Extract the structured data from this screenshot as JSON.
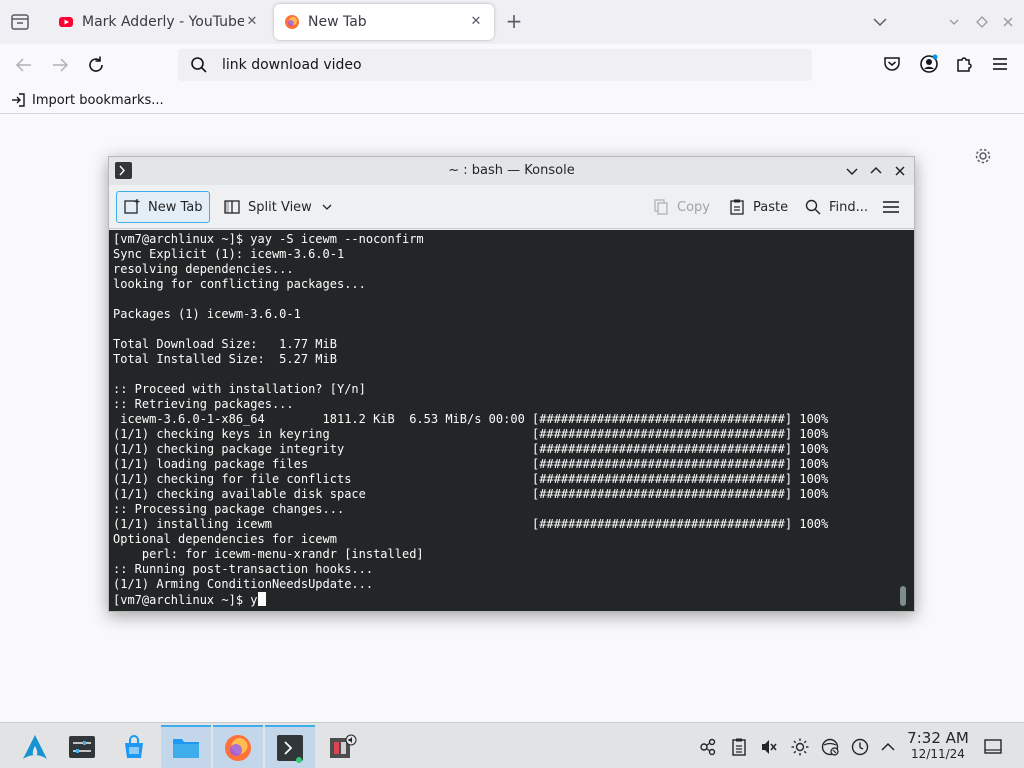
{
  "browser": {
    "tabs": [
      {
        "title": "Mark Adderly - YouTube",
        "favicon": "youtube-icon",
        "active": false
      },
      {
        "title": "New Tab",
        "favicon": "firefox-icon",
        "active": true
      }
    ],
    "url_value": "link download video",
    "bookmarks": {
      "import_label": "Import bookmarks..."
    }
  },
  "konsole": {
    "title": "~ : bash — Konsole",
    "toolbar": {
      "new_tab": "New Tab",
      "split_view": "Split View",
      "copy": "Copy",
      "paste": "Paste",
      "find": "Find..."
    },
    "terminal": {
      "lines": [
        "[vm7@archlinux ~]$ yay -S icewm --noconfirm",
        "Sync Explicit (1): icewm-3.6.0-1",
        "resolving dependencies...",
        "looking for conflicting packages...",
        "",
        "Packages (1) icewm-3.6.0-1",
        "",
        "Total Download Size:   1.77 MiB",
        "Total Installed Size:  5.27 MiB",
        "",
        ":: Proceed with installation? [Y/n]",
        ":: Retrieving packages...",
        " icewm-3.6.0-1-x86_64        1811.2 KiB  6.53 MiB/s 00:00 [##################################] 100%",
        "(1/1) checking keys in keyring                            [##################################] 100%",
        "(1/1) checking package integrity                          [##################################] 100%",
        "(1/1) loading package files                               [##################################] 100%",
        "(1/1) checking for file conflicts                         [##################################] 100%",
        "(1/1) checking available disk space                       [##################################] 100%",
        ":: Processing package changes...",
        "(1/1) installing icewm                                    [##################################] 100%",
        "Optional dependencies for icewm",
        "    perl: for icewm-menu-xrandr [installed]",
        ":: Running post-transaction hooks...",
        "(1/1) Arming ConditionNeedsUpdate..."
      ],
      "prompt": "[vm7@archlinux ~]$ ",
      "input": "y"
    }
  },
  "taskbar": {
    "time": "7:32 AM",
    "date": "12/11/24"
  },
  "colors": {
    "accent": "#3daee9",
    "terminal_bg": "#232627",
    "youtube_red": "#ff0033",
    "firefox_orange": "#ff7139"
  }
}
